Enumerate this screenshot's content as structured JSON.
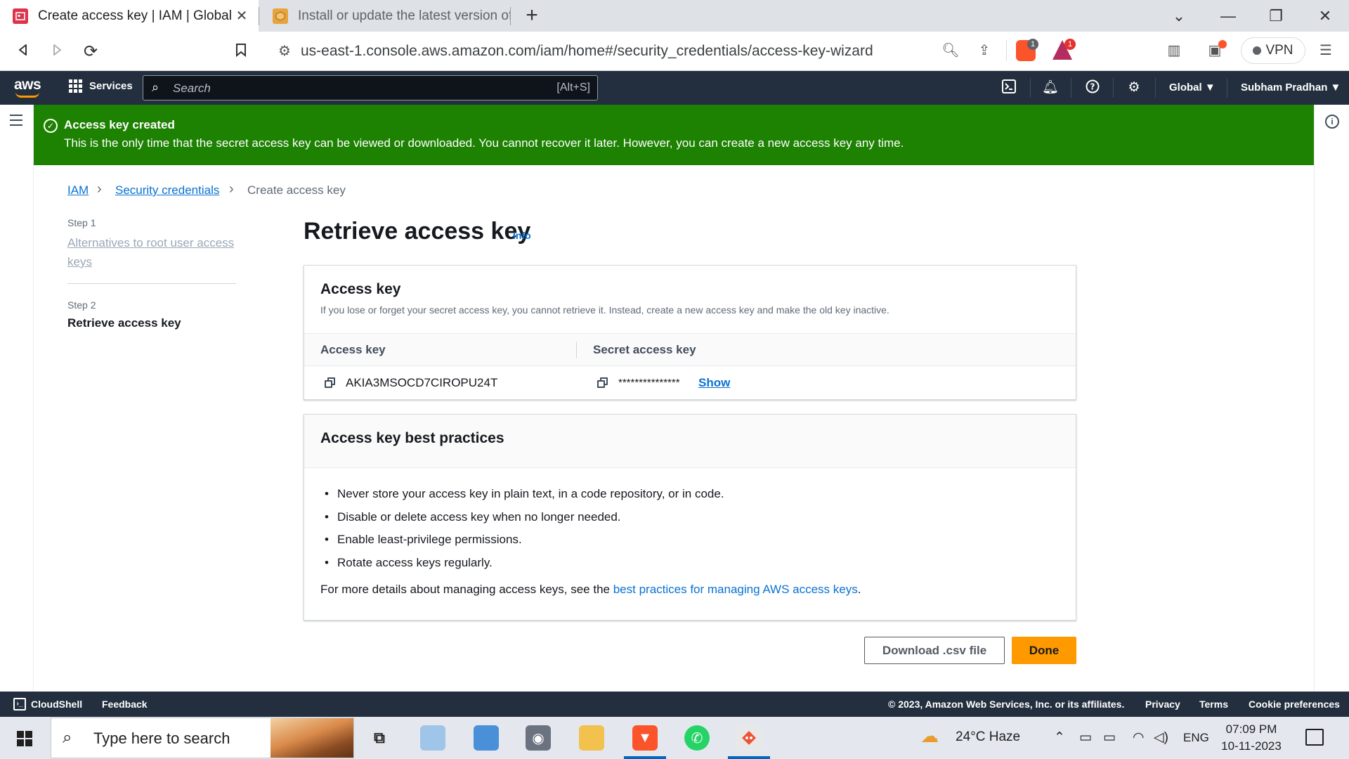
{
  "browser": {
    "tabs": [
      {
        "title": "Create access key | IAM | Global",
        "active": true
      },
      {
        "title": "Install or update the latest version of t",
        "active": false
      }
    ],
    "url": "us-east-1.console.aws.amazon.com/iam/home#/security_credentials/access-key-wizard",
    "badges": {
      "brave_shields": "1",
      "rewards": "1"
    },
    "vpn_label": "VPN"
  },
  "aws_nav": {
    "logo": "aws",
    "services_label": "Services",
    "search_placeholder": "Search",
    "search_shortcut": "[Alt+S]",
    "region": "Global",
    "user": "Subham Pradhan"
  },
  "flash": {
    "title": "Access key created",
    "message": "This is the only time that the secret access key can be viewed or downloaded. You cannot recover it later. However, you can create a new access key any time.",
    "color": "#1d8102"
  },
  "breadcrumb": {
    "items": [
      "IAM",
      "Security credentials",
      "Create access key"
    ]
  },
  "wizard": {
    "step1_label": "Step 1",
    "step1_title": "Alternatives to root user access keys",
    "step2_label": "Step 2",
    "step2_title": "Retrieve access key"
  },
  "page": {
    "title": "Retrieve access key",
    "info_link": "Info"
  },
  "access_key_card": {
    "title": "Access key",
    "description": "If you lose or forget your secret access key, you cannot retrieve it. Instead, create a new access key and make the old key inactive.",
    "columns": [
      "Access key",
      "Secret access key"
    ],
    "access_key_value": "AKIA3MSOCD7CIROPU24T",
    "secret_masked": "***************",
    "show_label": "Show"
  },
  "best_practices_card": {
    "title": "Access key best practices",
    "items": [
      "Never store your access key in plain text, in a code repository, or in code.",
      "Disable or delete access key when no longer needed.",
      "Enable least-privilege permissions.",
      "Rotate access keys regularly."
    ],
    "more_prefix": "For more details about managing access keys, see the ",
    "more_link": "best practices for managing AWS access keys",
    "more_suffix": "."
  },
  "actions": {
    "download": "Download .csv file",
    "done": "Done",
    "primary_color": "#ff9900"
  },
  "footer": {
    "cloudshell": "CloudShell",
    "feedback": "Feedback",
    "copyright": "© 2023, Amazon Web Services, Inc. or its affiliates.",
    "privacy": "Privacy",
    "terms": "Terms",
    "cookies": "Cookie preferences"
  },
  "taskbar": {
    "search_placeholder": "Type here to search",
    "weather": "24°C  Haze",
    "language": "ENG",
    "time": "07:09 PM",
    "date": "10-11-2023"
  }
}
